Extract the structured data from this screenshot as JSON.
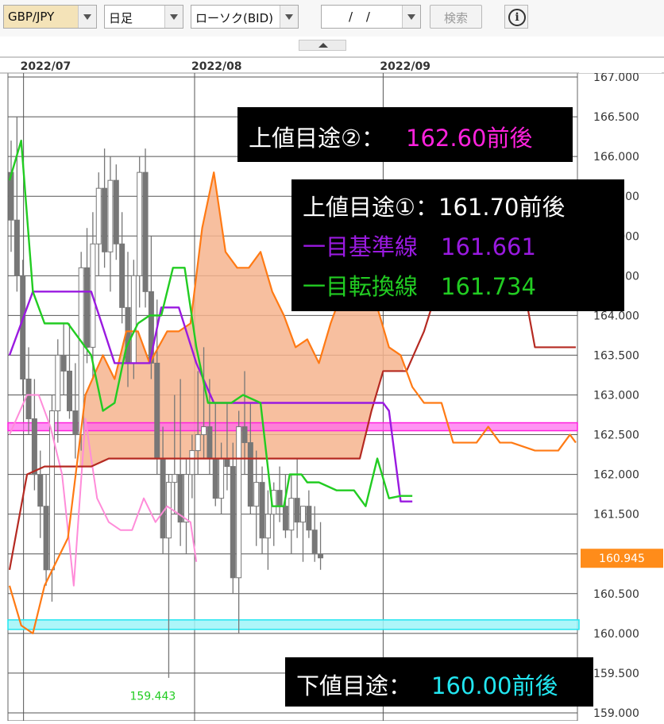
{
  "toolbar": {
    "symbol": "GBP/JPY",
    "period": "日足",
    "chart_type": "ローソク(BID)",
    "date_value": "/ /",
    "search_label": "検索",
    "info_icon": "info-icon"
  },
  "colors": {
    "kijun": "#9a1ae0",
    "tenkan": "#22cc22",
    "span_a": "#ff7a14",
    "span_b": "#b52a22",
    "chikou": "#ff8cd9",
    "cloud": "#f6b48e",
    "upper_target2": "#ff22dd",
    "lower_target": "#22e6f0",
    "price_marker": "#ff8c1a"
  },
  "chart_data": {
    "type": "candlestick",
    "x_labels": [
      "2022/07",
      "2022/08",
      "2022/09"
    ],
    "ylim": [
      158.9,
      167.05
    ],
    "y_ticks": [
      "159.000",
      "159.500",
      "160.000",
      "160.500",
      "161.000",
      "161.500",
      "162.000",
      "162.500",
      "163.000",
      "163.500",
      "164.000",
      "164.500",
      "165.000",
      "165.500",
      "166.000",
      "166.500",
      "167.000"
    ],
    "current_price": "160.945",
    "low_label": "159.443",
    "candles": [
      [
        165.8,
        166.2,
        164.8,
        165.2
      ],
      [
        165.2,
        166.5,
        164.3,
        164.5
      ],
      [
        164.5,
        164.7,
        163.0,
        163.2
      ],
      [
        163.2,
        163.6,
        162.5,
        162.7
      ],
      [
        162.7,
        163.2,
        161.8,
        162.0
      ],
      [
        162.0,
        162.3,
        161.2,
        161.6
      ],
      [
        161.6,
        162.0,
        160.6,
        160.8
      ],
      [
        160.8,
        163.0,
        160.4,
        162.8
      ],
      [
        162.8,
        163.7,
        162.4,
        163.5
      ],
      [
        163.5,
        163.9,
        163.0,
        163.3
      ],
      [
        163.3,
        163.9,
        162.7,
        162.8
      ],
      [
        162.8,
        163.4,
        162.2,
        162.5
      ],
      [
        162.5,
        164.8,
        162.3,
        164.6
      ],
      [
        164.6,
        165.1,
        163.4,
        163.6
      ],
      [
        163.6,
        165.3,
        163.2,
        164.9
      ],
      [
        164.9,
        165.8,
        164.5,
        165.6
      ],
      [
        165.6,
        166.1,
        164.6,
        164.8
      ],
      [
        164.8,
        166.0,
        164.3,
        165.7
      ],
      [
        165.7,
        165.9,
        164.7,
        164.9
      ],
      [
        164.9,
        165.3,
        163.9,
        164.1
      ],
      [
        164.1,
        164.8,
        163.1,
        163.4
      ],
      [
        163.4,
        164.7,
        163.2,
        164.5
      ],
      [
        164.5,
        166.0,
        164.1,
        165.8
      ],
      [
        165.8,
        166.1,
        164.1,
        164.3
      ],
      [
        164.3,
        165.0,
        163.2,
        163.4
      ],
      [
        163.4,
        164.2,
        162.0,
        162.2
      ],
      [
        162.2,
        162.6,
        161.0,
        161.2
      ],
      [
        161.2,
        162.0,
        159.44,
        161.9
      ],
      [
        161.9,
        163.0,
        161.5,
        162.0
      ],
      [
        162.0,
        163.2,
        161.1,
        161.4
      ],
      [
        161.4,
        162.2,
        161.0,
        162.0
      ],
      [
        162.0,
        162.5,
        161.7,
        162.3
      ],
      [
        162.3,
        163.3,
        162.0,
        162.5
      ],
      [
        162.5,
        163.6,
        162.2,
        162.6
      ],
      [
        162.6,
        163.2,
        162.0,
        162.2
      ],
      [
        162.2,
        162.9,
        161.6,
        161.7
      ],
      [
        161.7,
        162.4,
        161.5,
        162.2
      ],
      [
        162.2,
        162.9,
        161.8,
        162.1
      ],
      [
        162.1,
        162.4,
        160.5,
        160.7
      ],
      [
        160.7,
        162.8,
        160.0,
        162.6
      ],
      [
        162.6,
        163.3,
        162.0,
        162.4
      ],
      [
        162.4,
        162.9,
        161.5,
        161.6
      ],
      [
        161.6,
        162.3,
        161.1,
        161.9
      ],
      [
        161.9,
        162.1,
        161.0,
        161.2
      ],
      [
        161.2,
        161.8,
        160.8,
        161.5
      ],
      [
        161.5,
        161.9,
        161.1,
        161.8
      ],
      [
        161.8,
        162.1,
        161.4,
        161.6
      ],
      [
        161.6,
        162.0,
        161.2,
        161.3
      ],
      [
        161.3,
        162.0,
        161.0,
        161.7
      ],
      [
        161.7,
        162.2,
        161.2,
        161.4
      ],
      [
        161.4,
        161.6,
        160.9,
        161.6
      ],
      [
        161.6,
        161.8,
        161.2,
        161.3
      ],
      [
        161.3,
        161.6,
        160.9,
        161.0
      ],
      [
        161.0,
        161.4,
        160.8,
        160.95
      ]
    ],
    "series": [
      {
        "name": "一目基準線",
        "values": [
          [
            0,
            163.5
          ],
          [
            4,
            164.3
          ],
          [
            14,
            164.3
          ],
          [
            18,
            163.4
          ],
          [
            24,
            163.4
          ],
          [
            26,
            164.1
          ],
          [
            29,
            164.1
          ],
          [
            32,
            163.4
          ],
          [
            35,
            162.9
          ],
          [
            39,
            162.9
          ],
          [
            42,
            162.9
          ],
          [
            45,
            162.9
          ],
          [
            48,
            162.9
          ],
          [
            51,
            162.9
          ],
          [
            55,
            162.9
          ],
          [
            62,
            162.9
          ],
          [
            64,
            162.9
          ],
          [
            65,
            162.8
          ],
          [
            67,
            161.66
          ],
          [
            69,
            161.66
          ]
        ]
      },
      {
        "name": "一目転換線",
        "values": [
          [
            0,
            165.7
          ],
          [
            2,
            166.2
          ],
          [
            4,
            164.3
          ],
          [
            6,
            163.9
          ],
          [
            10,
            163.9
          ],
          [
            14,
            163.5
          ],
          [
            16,
            162.8
          ],
          [
            18,
            162.9
          ],
          [
            20,
            163.6
          ],
          [
            22,
            163.9
          ],
          [
            24,
            164.0
          ],
          [
            26,
            164.0
          ],
          [
            28,
            164.6
          ],
          [
            30,
            164.6
          ],
          [
            32,
            163.6
          ],
          [
            34,
            162.9
          ],
          [
            38,
            162.9
          ],
          [
            40,
            163.0
          ],
          [
            43,
            162.9
          ],
          [
            45,
            161.6
          ],
          [
            47,
            161.6
          ],
          [
            48,
            162.0
          ],
          [
            50,
            162.0
          ],
          [
            51,
            161.9
          ],
          [
            53,
            161.9
          ],
          [
            56,
            161.8
          ],
          [
            59,
            161.8
          ],
          [
            61,
            161.6
          ],
          [
            63,
            162.2
          ],
          [
            65,
            161.7
          ],
          [
            67,
            161.73
          ],
          [
            69,
            161.73
          ]
        ]
      },
      {
        "name": "先行スパンA",
        "values": [
          [
            0,
            160.6
          ],
          [
            2,
            160.1
          ],
          [
            4,
            160.0
          ],
          [
            6,
            160.6
          ],
          [
            8,
            160.9
          ],
          [
            10,
            161.2
          ],
          [
            13,
            163.0
          ],
          [
            16,
            163.5
          ],
          [
            18,
            163.2
          ],
          [
            20,
            163.8
          ],
          [
            22,
            163.8
          ],
          [
            24,
            163.4
          ],
          [
            27,
            163.8
          ],
          [
            29,
            163.8
          ],
          [
            31,
            163.9
          ],
          [
            33,
            165.1
          ],
          [
            35,
            165.8
          ],
          [
            37,
            164.8
          ],
          [
            39,
            164.6
          ],
          [
            41,
            164.6
          ],
          [
            43,
            164.8
          ],
          [
            45,
            164.3
          ],
          [
            47,
            164.0
          ],
          [
            49,
            163.6
          ],
          [
            51,
            163.7
          ],
          [
            53,
            163.4
          ],
          [
            55,
            163.9
          ],
          [
            57,
            164.3
          ],
          [
            59,
            164.3
          ],
          [
            61,
            164.3
          ],
          [
            63,
            164.1
          ],
          [
            65,
            163.6
          ],
          [
            67,
            163.5
          ],
          [
            69,
            163.1
          ],
          [
            71,
            162.9
          ],
          [
            74,
            162.9
          ],
          [
            76,
            162.4
          ],
          [
            80,
            162.4
          ],
          [
            82,
            162.6
          ],
          [
            84,
            162.4
          ],
          [
            86,
            162.4
          ],
          [
            90,
            162.3
          ],
          [
            94,
            162.3
          ],
          [
            96,
            162.5
          ],
          [
            97,
            162.4
          ]
        ]
      },
      {
        "name": "先行スパンB",
        "values": [
          [
            0,
            160.8
          ],
          [
            3,
            162.0
          ],
          [
            6,
            162.1
          ],
          [
            14,
            162.1
          ],
          [
            17,
            162.2
          ],
          [
            26,
            162.2
          ],
          [
            30,
            162.2
          ],
          [
            40,
            162.2
          ],
          [
            50,
            162.2
          ],
          [
            60,
            162.2
          ],
          [
            62,
            162.8
          ],
          [
            64,
            163.3
          ],
          [
            68,
            163.3
          ],
          [
            71,
            163.8
          ],
          [
            74,
            164.5
          ],
          [
            77,
            164.6
          ],
          [
            80,
            164.6
          ],
          [
            85,
            164.6
          ],
          [
            88,
            164.4
          ],
          [
            90,
            163.6
          ],
          [
            97,
            163.6
          ]
        ]
      },
      {
        "name": "遅行スパン",
        "values": [
          [
            0,
            162.5
          ],
          [
            3,
            163.0
          ],
          [
            5,
            163.0
          ],
          [
            7,
            162.6
          ],
          [
            9,
            162.0
          ],
          [
            11,
            160.6
          ],
          [
            13,
            162.7
          ],
          [
            15,
            161.7
          ],
          [
            17,
            161.4
          ],
          [
            19,
            161.3
          ],
          [
            21,
            161.3
          ],
          [
            23,
            161.7
          ],
          [
            25,
            161.4
          ],
          [
            27,
            161.6
          ],
          [
            29,
            161.5
          ],
          [
            31,
            161.4
          ],
          [
            32,
            160.9
          ]
        ]
      }
    ],
    "lines": [
      {
        "label": "上値目途②",
        "value": 162.6
      },
      {
        "label": "下値目途",
        "value": 160.1
      }
    ]
  },
  "annotations": {
    "upper2": {
      "label": "上値目途②：",
      "value": "162.60前後"
    },
    "upper1": {
      "label": "上値目途①：161.70前後",
      "kijun": "一目基準線　161.661",
      "tenkan": "一目転換線　161.734"
    },
    "lower": {
      "label": "下値目途：",
      "value": "160.00前後"
    }
  }
}
